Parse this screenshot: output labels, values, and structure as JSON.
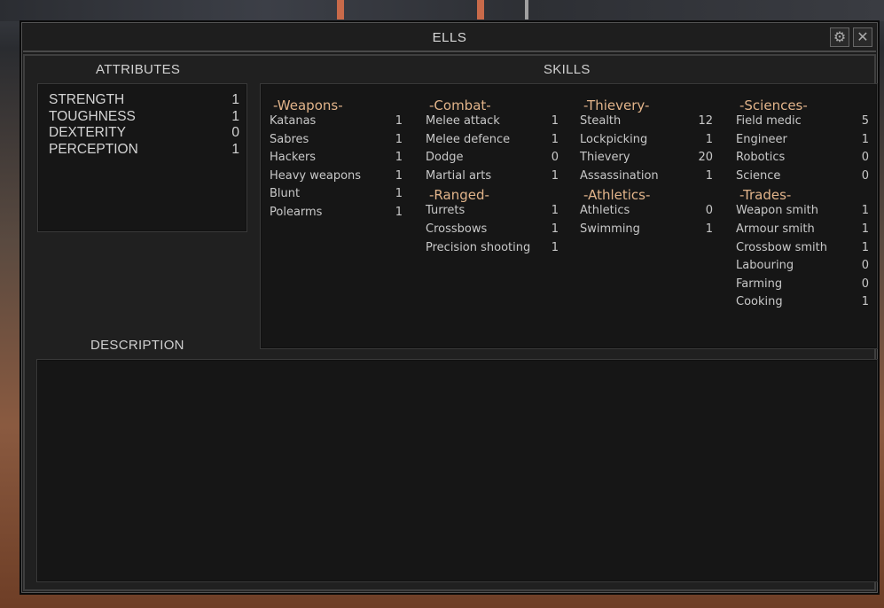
{
  "window": {
    "title": "ELLS"
  },
  "titlebar_buttons": [
    {
      "name": "settings-button",
      "icon": "gear-icon",
      "glyph": "⚙"
    },
    {
      "name": "close-button",
      "icon": "close-icon",
      "glyph": "✕"
    }
  ],
  "attributes": {
    "heading": "ATTRIBUTES",
    "items": [
      {
        "label": "STRENGTH",
        "value": "1"
      },
      {
        "label": "TOUGHNESS",
        "value": "1"
      },
      {
        "label": "DEXTERITY",
        "value": "0"
      },
      {
        "label": "PERCEPTION",
        "value": "1"
      }
    ]
  },
  "skills": {
    "heading": "SKILLS",
    "columns": [
      {
        "groups": [
          {
            "title": "-Weapons-",
            "items": [
              {
                "label": "Katanas",
                "value": "1"
              },
              {
                "label": "Sabres",
                "value": "1"
              },
              {
                "label": "Hackers",
                "value": "1"
              },
              {
                "label": "Heavy weapons",
                "value": "1"
              },
              {
                "label": "Blunt",
                "value": "1"
              },
              {
                "label": "Polearms",
                "value": "1"
              }
            ]
          }
        ]
      },
      {
        "groups": [
          {
            "title": "-Combat-",
            "items": [
              {
                "label": "Melee attack",
                "value": "1"
              },
              {
                "label": "Melee defence",
                "value": "1"
              },
              {
                "label": "Dodge",
                "value": "0"
              },
              {
                "label": "Martial arts",
                "value": "1"
              }
            ]
          },
          {
            "title": "-Ranged-",
            "items": [
              {
                "label": "Turrets",
                "value": "1"
              },
              {
                "label": "Crossbows",
                "value": "1"
              },
              {
                "label": "Precision shooting",
                "value": "1"
              }
            ]
          }
        ]
      },
      {
        "groups": [
          {
            "title": "-Thievery-",
            "items": [
              {
                "label": "Stealth",
                "value": "12"
              },
              {
                "label": "Lockpicking",
                "value": "1"
              },
              {
                "label": "Thievery",
                "value": "20"
              },
              {
                "label": "Assassination",
                "value": "1"
              }
            ]
          },
          {
            "title": "-Athletics-",
            "items": [
              {
                "label": "Athletics",
                "value": "0"
              },
              {
                "label": "Swimming",
                "value": "1"
              }
            ]
          }
        ]
      },
      {
        "groups": [
          {
            "title": "-Sciences-",
            "items": [
              {
                "label": "Field medic",
                "value": "5"
              },
              {
                "label": "Engineer",
                "value": "1"
              },
              {
                "label": "Robotics",
                "value": "0"
              },
              {
                "label": "Science",
                "value": "0"
              }
            ]
          },
          {
            "title": "-Trades-",
            "items": [
              {
                "label": "Weapon smith",
                "value": "1"
              },
              {
                "label": "Armour smith",
                "value": "1"
              },
              {
                "label": "Crossbow smith",
                "value": "1"
              },
              {
                "label": "Labouring",
                "value": "0"
              },
              {
                "label": "Farming",
                "value": "0"
              },
              {
                "label": "Cooking",
                "value": "1"
              }
            ]
          }
        ]
      }
    ]
  },
  "description": {
    "heading": "DESCRIPTION",
    "text": ""
  }
}
